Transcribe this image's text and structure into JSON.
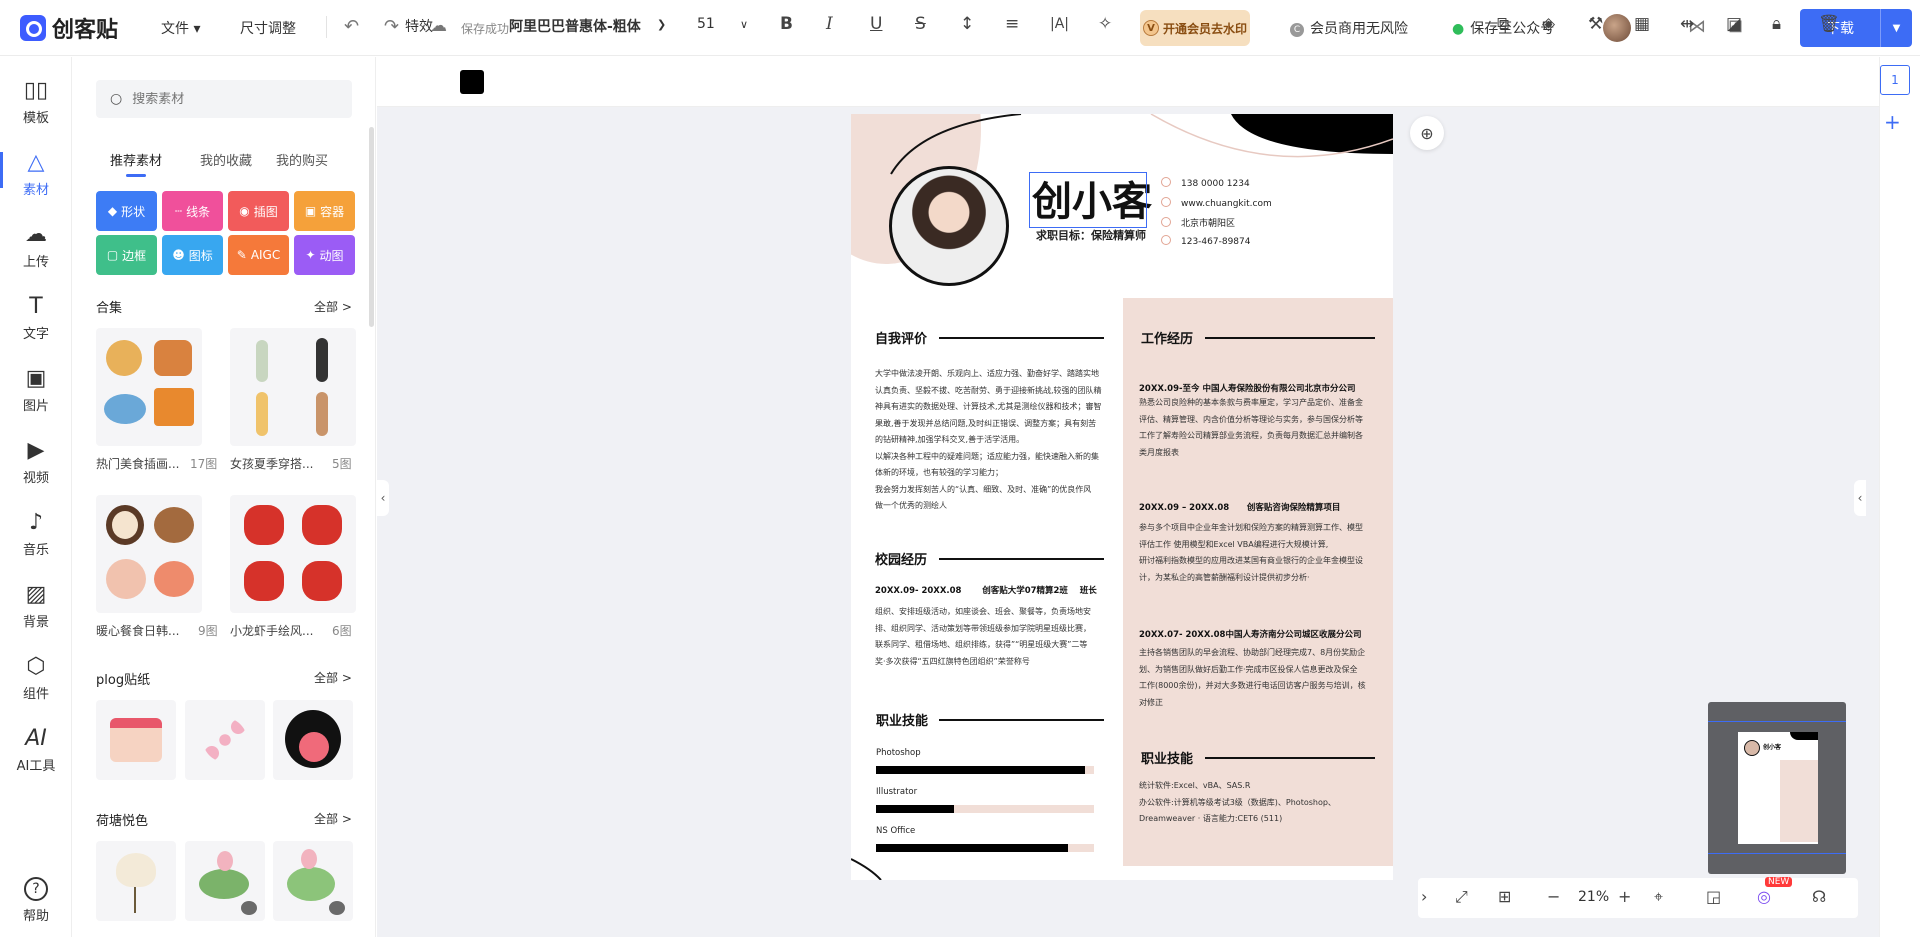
{
  "header": {
    "brand": "创客贴",
    "file_menu": "文件",
    "resize": "尺寸调整",
    "save_status": "保存成功",
    "vip": "开通会员去水印",
    "vip_mark": "V",
    "commercial": "会员商用无风险",
    "commercial_mark": "C",
    "wechat": "保存至公众号",
    "download": "下载"
  },
  "leftnav": {
    "items": [
      {
        "label": "模板",
        "icon": "template-icon"
      },
      {
        "label": "素材",
        "icon": "material-icon"
      },
      {
        "label": "上传",
        "icon": "upload-icon"
      },
      {
        "label": "文字",
        "icon": "text-icon"
      },
      {
        "label": "图片",
        "icon": "image-icon"
      },
      {
        "label": "视频",
        "icon": "video-icon"
      },
      {
        "label": "音乐",
        "icon": "music-icon"
      },
      {
        "label": "背景",
        "icon": "background-icon"
      },
      {
        "label": "组件",
        "icon": "component-icon"
      },
      {
        "label": "AI工具",
        "icon": "ai-icon",
        "glyph": "AI"
      },
      {
        "label": "帮助",
        "icon": "help-icon",
        "glyph": "?"
      }
    ]
  },
  "panel": {
    "search_placeholder": "搜索素材",
    "tabs": [
      "推荐素材",
      "我的收藏",
      "我的购买"
    ],
    "categories": [
      {
        "label": "形状",
        "color": "#3d7cf5"
      },
      {
        "label": "线条",
        "color": "#f0509b"
      },
      {
        "label": "插图",
        "color": "#f25b5b"
      },
      {
        "label": "容器",
        "color": "#f5a13a"
      },
      {
        "label": "边框",
        "color": "#3fbf8a"
      },
      {
        "label": "图标",
        "color": "#38a7f0"
      },
      {
        "label": "AIGC",
        "color": "#f5793a"
      },
      {
        "label": "动图",
        "color": "#9b5cf5"
      }
    ],
    "sections": {
      "collection": {
        "title": "合集",
        "more": "全部 >"
      },
      "plog": {
        "title": "plog贴纸",
        "more": "全部 >"
      },
      "lotus": {
        "title": "荷塘悦色",
        "more": "全部 >"
      }
    },
    "collections": [
      {
        "caption": "热门美食插画...",
        "count": "17图"
      },
      {
        "caption": "女孩夏季穿搭...",
        "count": "5图"
      },
      {
        "caption": "暖心餐食日韩...",
        "count": "9图"
      },
      {
        "caption": "小龙虾手绘风...",
        "count": "6图"
      }
    ]
  },
  "toolbar": {
    "effects": "特效",
    "font": "阿里巴巴普惠体-粗体",
    "size": "51",
    "bold": "B",
    "italic": "I",
    "underline": "U",
    "strike": "S"
  },
  "page_num": "1",
  "resume": {
    "name": "创小客",
    "goal": "求职目标：保险精算师",
    "contacts": [
      "138 0000 1234",
      "www.chuangkit.com",
      "北京市朝阳区",
      "123-467-89874"
    ],
    "self_title": "自我评价",
    "self_text": "大学中做法凌开朗、乐观向上、适应力强、勤奋好学、踏踏实地\n认真负责、坚毅不拔、吃苦耐劳、勇于迎接新挑战,较强的团队精\n神具有进实的数据处理、计算技术,尤其是测绘仪器和技术；審智\n果敢,善于发现并总结问题,及时纠正错误、调整方案；具有刻苦\n的钻研精神,加强学科交叉,善于活学活用。\n以解决各种工程中的疑难问题；适应能力强，能快速融入新的集\n体新的环境，也有较强的学习能力；\n我会努力发挥刻苦人的“认真、细致、及时、准确”的优良作风\n做一个优秀的测绘人",
    "campus_title": "校园经历",
    "campus_head": "20XX.09- 20XX.08       创客贴大学07精算2班    班长",
    "campus_text": "组织、安排班级活动，如座谈会、班会、聚餐等，负责场地安\n排、组织同学、活动策划等带领班级参加学院明星班级比赛，\n联系同学、租借场地、组织排练，获得”“明星班级大赛”二等\n奖·多次获得“五四红旗特色团组织”荣誉称号",
    "skills_title": "职业技能",
    "skills": [
      {
        "name": "Photoshop",
        "level": 0.96
      },
      {
        "name": "Illustrator",
        "level": 0.36
      },
      {
        "name": "NS Office",
        "level": 0.88
      }
    ],
    "work_title": "工作经历",
    "works": [
      {
        "head": "20XX.09-至今 中国人寿保险股份有限公司北京市分公司",
        "text": "熟悉公司良险种的基本条款与费率厘定，学习产品定价、准备金\n评估、精算管理、内含价值分析等理论与实务，参与国保分析等\n工作了解寿险公司精算部业务流程，负责每月数据汇总并编制各\n类月度报表"
      },
      {
        "head": "20XX.09 – 20XX.08      创客贴咨询保险精算项目",
        "text": "参与多个项目中企业年金计划和保险方案的精算测算工作、模型\n评估工作 使用模型和Excel VBA编程进行大规模计算,\n研讨福利指数模型的应用改进某国有商业银行的企业年金模型设\n计，为某私企的高管薪酬福利设计提供初步分析·"
      },
      {
        "head": "20XX.07- 20XX.08中国人寿济南分公司城区收展分公司",
        "text": "主持各销售团队的早会流程、协助部门经理完成7、8月份奖励企\n划、为销售团队做好后勤工作·完成市区投保人信息更改及保全\n工作(8000余份)，并对大多数进行电话回访客户服务与培训，核\n对修正"
      }
    ],
    "skills2_title": "职业技能",
    "skills2_text": "统计软件:Excel、vBA、SAS.R\n办公软件:计算机等级考试3级（数据库)、Photoshop、\nDreamweaver · 语言能力:CET6 (511)"
  },
  "zoom": "21%",
  "new_badge": "NEW"
}
